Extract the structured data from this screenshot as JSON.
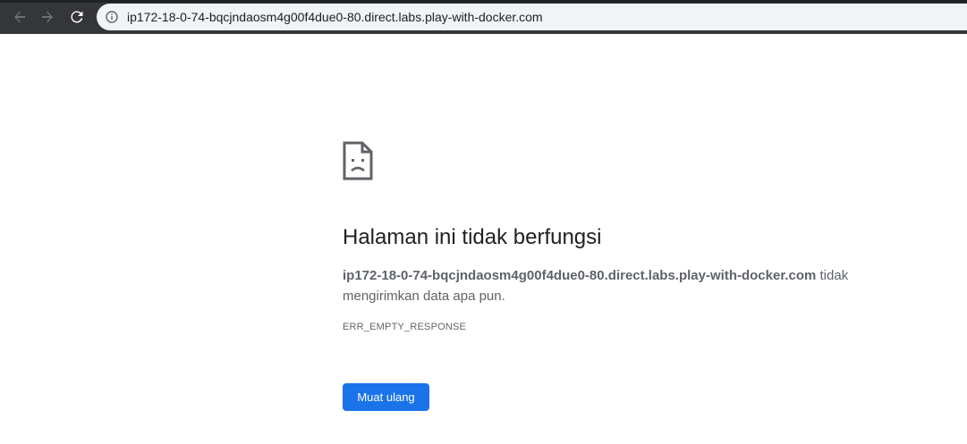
{
  "browser": {
    "url": "ip172-18-0-74-bqcjndaosm4g00f4due0-80.direct.labs.play-with-docker.com",
    "icons": {
      "back": "arrow-left-icon",
      "forward": "arrow-right-icon",
      "reload": "reload-icon",
      "site_info": "info-icon"
    }
  },
  "error_page": {
    "icon": "sad-document-icon",
    "title": "Halaman ini tidak berfungsi",
    "host": "ip172-18-0-74-bqcjndaosm4g00f4due0-80.direct.labs.play-with-docker.com",
    "message_suffix": " tidak mengirimkan data apa pun.",
    "error_code": "ERR_EMPTY_RESPONSE",
    "reload_label": "Muat ulang"
  },
  "colors": {
    "toolbar": "#35363a",
    "omnibox": "#f1f3f4",
    "primary_button": "#1a73e8",
    "text_dark": "#202124",
    "text_muted": "#5f6368"
  }
}
